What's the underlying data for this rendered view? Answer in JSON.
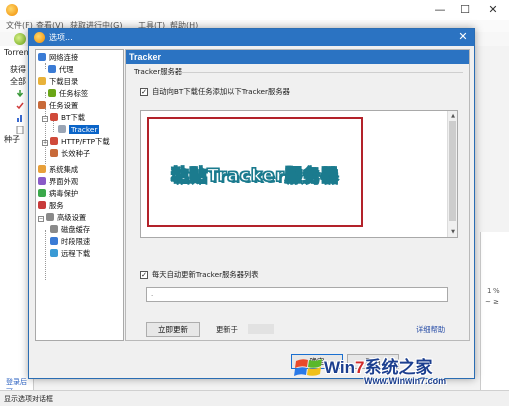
{
  "main": {
    "menu": [
      "文件(F)",
      "查看(V)",
      "获取进行中(G)",
      "工具(T)",
      "帮助(H)"
    ],
    "window_controls": [
      "—",
      "☐",
      "✕"
    ],
    "left_panel_title": "Torren",
    "left_items": [
      "获得",
      "全部",
      "种子"
    ],
    "login_link": "登录后可",
    "status": "显示选项对话框",
    "right_strip": [
      "1",
      "%",
      "~ ≥"
    ]
  },
  "dialog": {
    "title": "选项...",
    "close": "✕",
    "tree": [
      {
        "label": "网络连接",
        "icon_color": "#3a7bd5"
      },
      {
        "label": "代理",
        "icon_color": "#3a7bd5"
      },
      {
        "label": "下载目录",
        "icon_color": "#e8b23a"
      },
      {
        "label": "任务标签",
        "icon_color": "#6aa616"
      },
      {
        "label": "任务设置",
        "icon_color": "#c86a3a"
      },
      {
        "label": "BT下载",
        "icon_color": "#d04a3a"
      },
      {
        "label": "Tracker",
        "icon_color": "#9aa5b5"
      },
      {
        "label": "HTTP/FTP下载",
        "icon_color": "#d04a3a"
      },
      {
        "label": "长效种子",
        "icon_color": "#c86a3a"
      },
      {
        "label": "系统集成",
        "icon_color": "#e8a03a"
      },
      {
        "label": "界面外观",
        "icon_color": "#8a5ac8"
      },
      {
        "label": "病毒保护",
        "icon_color": "#3aa84a"
      },
      {
        "label": "服务",
        "icon_color": "#c83a3a"
      },
      {
        "label": "高级设置",
        "icon_color": "#8a8a8a"
      },
      {
        "label": "磁盘缓存",
        "icon_color": "#8a8a8a"
      },
      {
        "label": "时段限速",
        "icon_color": "#3a7bd5"
      },
      {
        "label": "远程下载",
        "icon_color": "#3a9ad5"
      }
    ],
    "panel": {
      "header": "Tracker",
      "group_label": "Tracker服务器",
      "auto_add_checkbox": {
        "label": "自动向BT下载任务添加以下Tracker服务器",
        "checked": "✓"
      },
      "overlay_text": "粘贴Tracker服务器",
      "auto_update_checkbox": {
        "label": "每天自动更新Tracker服务器列表",
        "checked": "✓"
      },
      "url_value": ".",
      "update_button": "立即更新",
      "updated_label": "更新于",
      "help_link": "详细帮助"
    },
    "ok_button": "确定",
    "cancel_button": "取消"
  },
  "watermark": {
    "title_a": "Win",
    "title_b": "7",
    "title_c": "系统之家",
    "url": "Www.Winwin7.com"
  },
  "colors": {
    "accent": "#2b73c2",
    "highlight_frame": "#b3222a",
    "selected": "#0a64c8"
  }
}
